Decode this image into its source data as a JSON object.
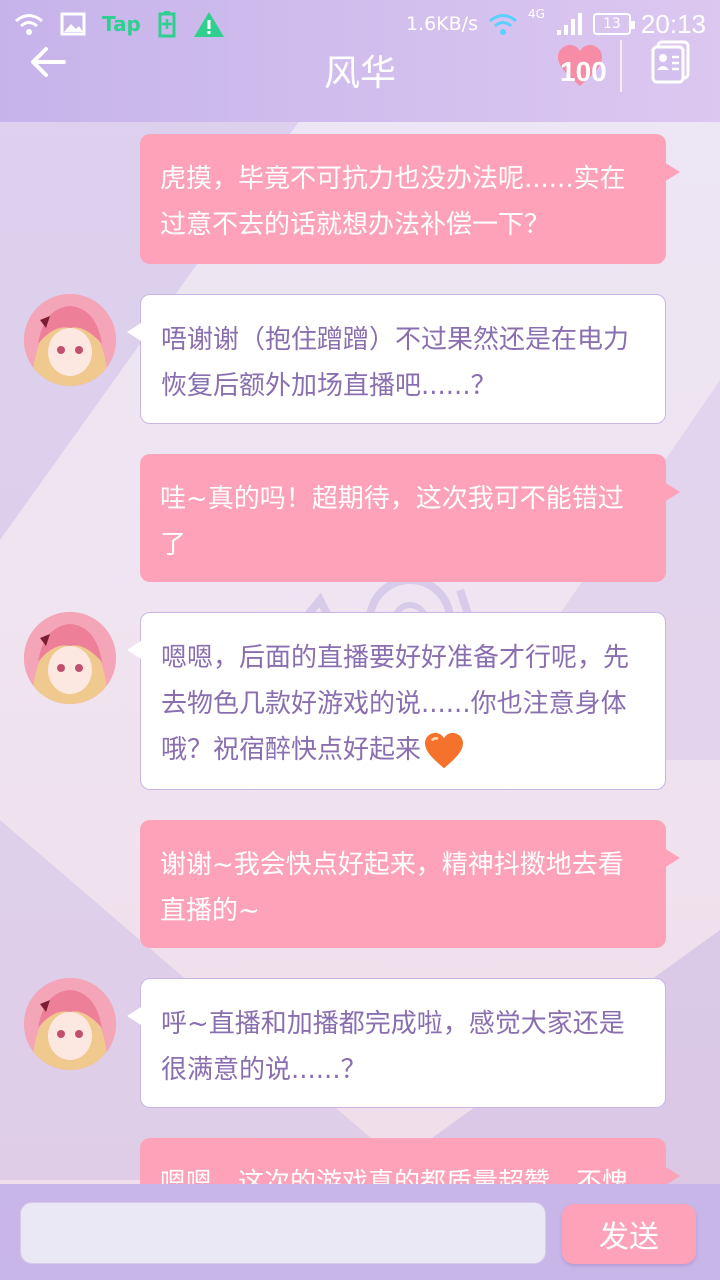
{
  "status_bar": {
    "tap_label": "Tap",
    "net_speed": "1.6KB/s",
    "network": "4G",
    "battery": "13",
    "time": "20:13"
  },
  "header": {
    "title": "风华",
    "heart_count": "100"
  },
  "messages": [
    {
      "side": "out",
      "text": "虎摸，毕竟不可抗力也没办法呢......实在过意不去的话就想办法补偿一下？"
    },
    {
      "side": "in",
      "text": "唔谢谢（抱住蹭蹭）不过果然还是在电力恢复后额外加场直播吧......？"
    },
    {
      "side": "out",
      "text": "哇~真的吗！超期待，这次我可不能错过了"
    },
    {
      "side": "in",
      "text": "嗯嗯，后面的直播要好好准备才行呢，先去物色几款好游戏的说......你也注意身体哦？祝宿醉快点好起来",
      "emoji": "heart-icon"
    },
    {
      "side": "out",
      "text": "谢谢~我会快点好起来，精神抖擞地去看直播的~"
    },
    {
      "side": "in",
      "text": "呼~直播和加播都完成啦，感觉大家还是很满意的说......？"
    },
    {
      "side": "out",
      "text": "嗯嗯，这次的游戏真的都质量超赞，不愧"
    }
  ],
  "input": {
    "placeholder": "",
    "value": "",
    "send_label": "发送"
  },
  "colors": {
    "header": "#c6b3ea",
    "outgoing_bubble": "#fda2b8",
    "incoming_text": "#8a6fb0",
    "input_bar": "#c8b6e8"
  }
}
